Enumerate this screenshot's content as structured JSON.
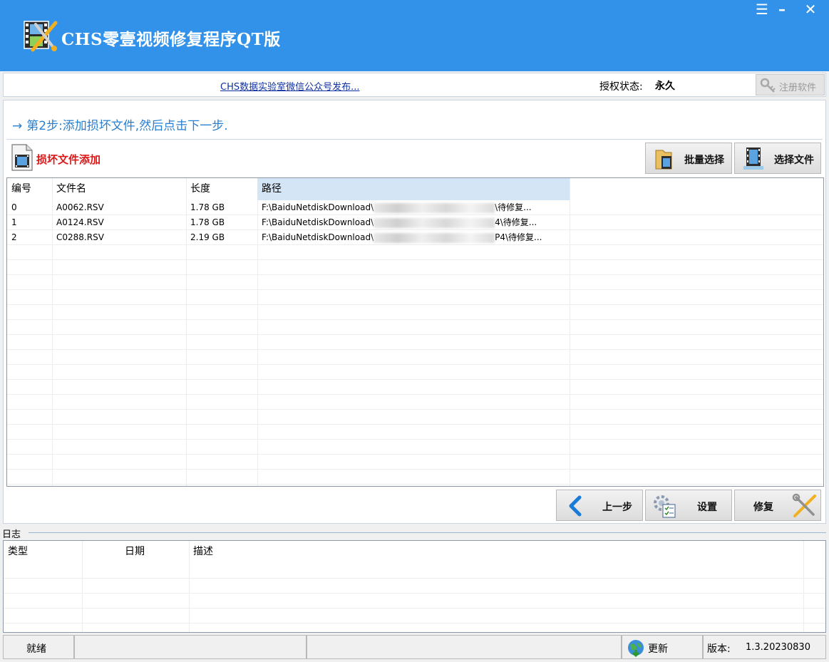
{
  "app": {
    "title": "CHS零壹视频修复程序QT版",
    "window_buttons": {
      "menu": "☰",
      "minimize": "–",
      "close": "✕"
    }
  },
  "infobar": {
    "wechat_link": "CHS数据实验室微信公众号发布...",
    "auth_label": "授权状态:",
    "auth_value": "永久",
    "register_label": "注册软件"
  },
  "step": {
    "arrow": "→",
    "text": "第2步:添加损坏文件,然后点击下一步."
  },
  "section": {
    "title": "损坏文件添加"
  },
  "toolbar": {
    "batch_select": "批量选择",
    "select_file": "选择文件"
  },
  "file_table": {
    "columns": [
      "编号",
      "文件名",
      "长度",
      "路径"
    ],
    "rows": [
      {
        "id": "0",
        "name": "A0062.RSV",
        "size": "1.78 GB",
        "path_start": "F:\\BaiduNetdiskDownload\\",
        "path_end": "\\待修复..."
      },
      {
        "id": "1",
        "name": "A0124.RSV",
        "size": "1.78 GB",
        "path_start": "F:\\BaiduNetdiskDownload\\",
        "path_end": "4\\待修复..."
      },
      {
        "id": "2",
        "name": "C0288.RSV",
        "size": "2.19 GB",
        "path_start": "F:\\BaiduNetdiskDownload\\",
        "path_end": "P4\\待修复..."
      }
    ]
  },
  "actions": {
    "prev": "上一步",
    "settings": "设置",
    "repair": "修复"
  },
  "log": {
    "label": "日志",
    "columns": [
      "类型",
      "日期",
      "描述"
    ]
  },
  "statusbar": {
    "status": "就绪",
    "update": "更新",
    "version_label": "版本:",
    "version_value": "1.3.20230830"
  },
  "colors": {
    "titlebar": "#3291e8",
    "step_text": "#2a80d0",
    "section_title": "#e01515",
    "link": "#1030a0"
  }
}
